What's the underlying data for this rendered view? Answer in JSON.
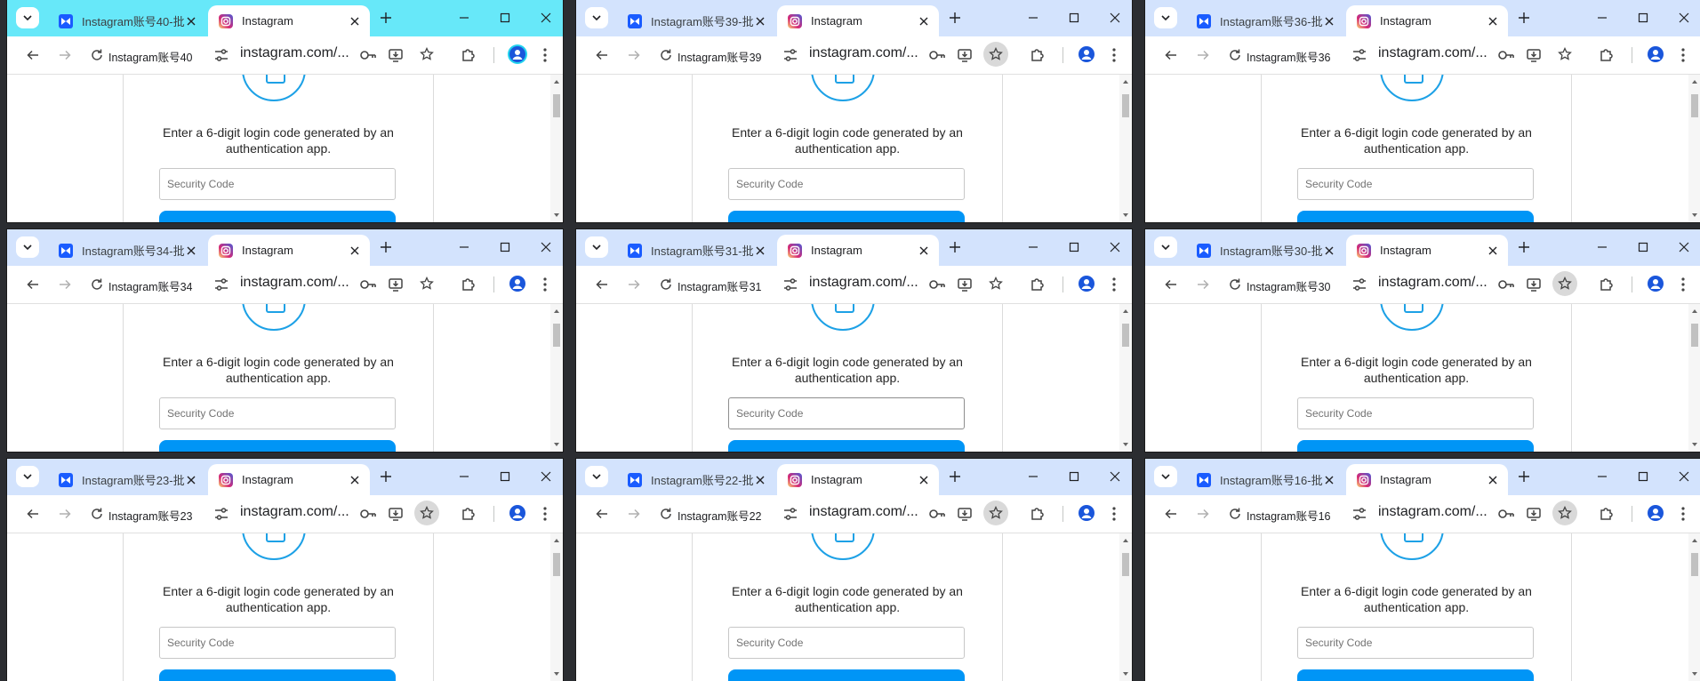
{
  "tab_inactive_prefix": "Instagram账号",
  "tab_inactive_suffix": "-批",
  "active_tab_title": "Instagram",
  "url_text": "instagram.com/...",
  "prompt_text": "Enter a 6-digit login code generated by an authentication app.",
  "input_placeholder": "Security Code",
  "colors": {
    "tabstrip": "#d3e3fd",
    "tabstrip_focused": "#67e8f9",
    "instagram_blue": "#0095f6",
    "icon_ring": "#1da1e6",
    "background": "#2b2d31"
  },
  "icons": {
    "tab_search": "chevron-down-icon",
    "inactive_favicon": "butterfly-app-icon",
    "active_favicon": "instagram-icon",
    "close": "close-icon",
    "new_tab": "plus-icon",
    "back": "arrow-left-icon",
    "forward": "arrow-right-icon",
    "reload": "reload-icon",
    "site_info": "tune-icon",
    "password": "key-icon",
    "install": "install-app-icon",
    "bookmark": "star-icon",
    "extensions": "puzzle-icon",
    "profile": "person-icon",
    "menu": "kebab-menu-icon",
    "lock": "lock-icon"
  },
  "windows": [
    {
      "account": "40",
      "inactive_tab_label": "Instagram账号40-批",
      "bookmark_label": "Instagram账号40",
      "focused": true,
      "star_highlight": false,
      "avatar_teal": true,
      "caret": false
    },
    {
      "account": "39",
      "inactive_tab_label": "Instagram账号39-批",
      "bookmark_label": "Instagram账号39",
      "focused": false,
      "star_highlight": true,
      "avatar_teal": false,
      "caret": false
    },
    {
      "account": "36",
      "inactive_tab_label": "Instagram账号36-批",
      "bookmark_label": "Instagram账号36",
      "focused": false,
      "star_highlight": false,
      "avatar_teal": false,
      "caret": false
    },
    {
      "account": "34",
      "inactive_tab_label": "Instagram账号34-批",
      "bookmark_label": "Instagram账号34",
      "focused": false,
      "star_highlight": false,
      "avatar_teal": false,
      "caret": false
    },
    {
      "account": "31",
      "inactive_tab_label": "Instagram账号31-批",
      "bookmark_label": "Instagram账号31",
      "focused": false,
      "star_highlight": false,
      "avatar_teal": false,
      "caret": true
    },
    {
      "account": "30",
      "inactive_tab_label": "Instagram账号30-批",
      "bookmark_label": "Instagram账号30",
      "focused": false,
      "star_highlight": true,
      "avatar_teal": false,
      "caret": false
    },
    {
      "account": "23",
      "inactive_tab_label": "Instagram账号23-批",
      "bookmark_label": "Instagram账号23",
      "focused": false,
      "star_highlight": true,
      "avatar_teal": false,
      "caret": false
    },
    {
      "account": "22",
      "inactive_tab_label": "Instagram账号22-批",
      "bookmark_label": "Instagram账号22",
      "focused": false,
      "star_highlight": true,
      "avatar_teal": false,
      "caret": false
    },
    {
      "account": "16",
      "inactive_tab_label": "Instagram账号16-批",
      "bookmark_label": "Instagram账号16",
      "focused": false,
      "star_highlight": true,
      "avatar_teal": false,
      "caret": false
    }
  ]
}
